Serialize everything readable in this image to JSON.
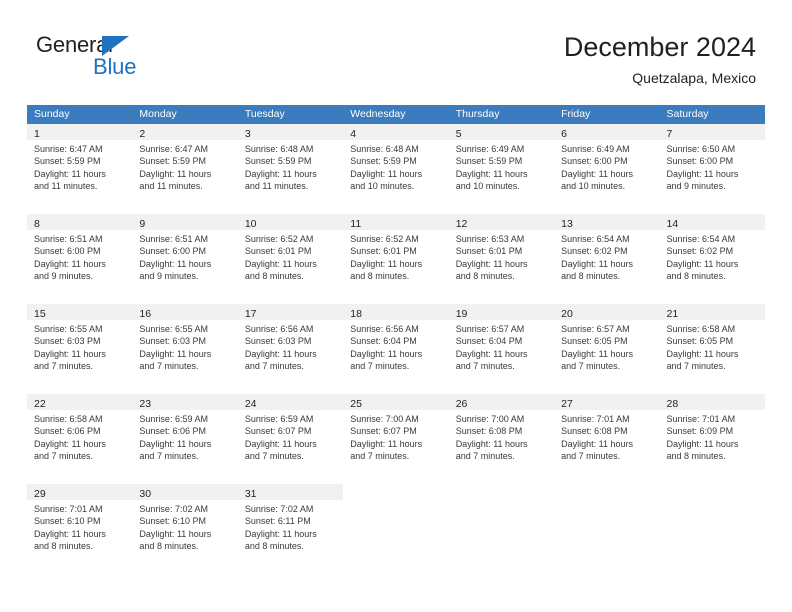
{
  "brand": {
    "name_line1": "General",
    "name_line2": "Blue",
    "accent_color": "#1e73be"
  },
  "header": {
    "title": "December 2024",
    "subtitle": "Quetzalapa, Mexico"
  },
  "calendar": {
    "header_color": "#3a7cbe",
    "daynum_band_color": "#f1f1f1",
    "weekdays": [
      "Sunday",
      "Monday",
      "Tuesday",
      "Wednesday",
      "Thursday",
      "Friday",
      "Saturday"
    ],
    "weeks": [
      [
        {
          "day": "1",
          "sunrise": "Sunrise: 6:47 AM",
          "sunset": "Sunset: 5:59 PM",
          "daylight_line1": "Daylight: 11 hours",
          "daylight_line2": "and 11 minutes."
        },
        {
          "day": "2",
          "sunrise": "Sunrise: 6:47 AM",
          "sunset": "Sunset: 5:59 PM",
          "daylight_line1": "Daylight: 11 hours",
          "daylight_line2": "and 11 minutes."
        },
        {
          "day": "3",
          "sunrise": "Sunrise: 6:48 AM",
          "sunset": "Sunset: 5:59 PM",
          "daylight_line1": "Daylight: 11 hours",
          "daylight_line2": "and 11 minutes."
        },
        {
          "day": "4",
          "sunrise": "Sunrise: 6:48 AM",
          "sunset": "Sunset: 5:59 PM",
          "daylight_line1": "Daylight: 11 hours",
          "daylight_line2": "and 10 minutes."
        },
        {
          "day": "5",
          "sunrise": "Sunrise: 6:49 AM",
          "sunset": "Sunset: 5:59 PM",
          "daylight_line1": "Daylight: 11 hours",
          "daylight_line2": "and 10 minutes."
        },
        {
          "day": "6",
          "sunrise": "Sunrise: 6:49 AM",
          "sunset": "Sunset: 6:00 PM",
          "daylight_line1": "Daylight: 11 hours",
          "daylight_line2": "and 10 minutes."
        },
        {
          "day": "7",
          "sunrise": "Sunrise: 6:50 AM",
          "sunset": "Sunset: 6:00 PM",
          "daylight_line1": "Daylight: 11 hours",
          "daylight_line2": "and 9 minutes."
        }
      ],
      [
        {
          "day": "8",
          "sunrise": "Sunrise: 6:51 AM",
          "sunset": "Sunset: 6:00 PM",
          "daylight_line1": "Daylight: 11 hours",
          "daylight_line2": "and 9 minutes."
        },
        {
          "day": "9",
          "sunrise": "Sunrise: 6:51 AM",
          "sunset": "Sunset: 6:00 PM",
          "daylight_line1": "Daylight: 11 hours",
          "daylight_line2": "and 9 minutes."
        },
        {
          "day": "10",
          "sunrise": "Sunrise: 6:52 AM",
          "sunset": "Sunset: 6:01 PM",
          "daylight_line1": "Daylight: 11 hours",
          "daylight_line2": "and 8 minutes."
        },
        {
          "day": "11",
          "sunrise": "Sunrise: 6:52 AM",
          "sunset": "Sunset: 6:01 PM",
          "daylight_line1": "Daylight: 11 hours",
          "daylight_line2": "and 8 minutes."
        },
        {
          "day": "12",
          "sunrise": "Sunrise: 6:53 AM",
          "sunset": "Sunset: 6:01 PM",
          "daylight_line1": "Daylight: 11 hours",
          "daylight_line2": "and 8 minutes."
        },
        {
          "day": "13",
          "sunrise": "Sunrise: 6:54 AM",
          "sunset": "Sunset: 6:02 PM",
          "daylight_line1": "Daylight: 11 hours",
          "daylight_line2": "and 8 minutes."
        },
        {
          "day": "14",
          "sunrise": "Sunrise: 6:54 AM",
          "sunset": "Sunset: 6:02 PM",
          "daylight_line1": "Daylight: 11 hours",
          "daylight_line2": "and 8 minutes."
        }
      ],
      [
        {
          "day": "15",
          "sunrise": "Sunrise: 6:55 AM",
          "sunset": "Sunset: 6:03 PM",
          "daylight_line1": "Daylight: 11 hours",
          "daylight_line2": "and 7 minutes."
        },
        {
          "day": "16",
          "sunrise": "Sunrise: 6:55 AM",
          "sunset": "Sunset: 6:03 PM",
          "daylight_line1": "Daylight: 11 hours",
          "daylight_line2": "and 7 minutes."
        },
        {
          "day": "17",
          "sunrise": "Sunrise: 6:56 AM",
          "sunset": "Sunset: 6:03 PM",
          "daylight_line1": "Daylight: 11 hours",
          "daylight_line2": "and 7 minutes."
        },
        {
          "day": "18",
          "sunrise": "Sunrise: 6:56 AM",
          "sunset": "Sunset: 6:04 PM",
          "daylight_line1": "Daylight: 11 hours",
          "daylight_line2": "and 7 minutes."
        },
        {
          "day": "19",
          "sunrise": "Sunrise: 6:57 AM",
          "sunset": "Sunset: 6:04 PM",
          "daylight_line1": "Daylight: 11 hours",
          "daylight_line2": "and 7 minutes."
        },
        {
          "day": "20",
          "sunrise": "Sunrise: 6:57 AM",
          "sunset": "Sunset: 6:05 PM",
          "daylight_line1": "Daylight: 11 hours",
          "daylight_line2": "and 7 minutes."
        },
        {
          "day": "21",
          "sunrise": "Sunrise: 6:58 AM",
          "sunset": "Sunset: 6:05 PM",
          "daylight_line1": "Daylight: 11 hours",
          "daylight_line2": "and 7 minutes."
        }
      ],
      [
        {
          "day": "22",
          "sunrise": "Sunrise: 6:58 AM",
          "sunset": "Sunset: 6:06 PM",
          "daylight_line1": "Daylight: 11 hours",
          "daylight_line2": "and 7 minutes."
        },
        {
          "day": "23",
          "sunrise": "Sunrise: 6:59 AM",
          "sunset": "Sunset: 6:06 PM",
          "daylight_line1": "Daylight: 11 hours",
          "daylight_line2": "and 7 minutes."
        },
        {
          "day": "24",
          "sunrise": "Sunrise: 6:59 AM",
          "sunset": "Sunset: 6:07 PM",
          "daylight_line1": "Daylight: 11 hours",
          "daylight_line2": "and 7 minutes."
        },
        {
          "day": "25",
          "sunrise": "Sunrise: 7:00 AM",
          "sunset": "Sunset: 6:07 PM",
          "daylight_line1": "Daylight: 11 hours",
          "daylight_line2": "and 7 minutes."
        },
        {
          "day": "26",
          "sunrise": "Sunrise: 7:00 AM",
          "sunset": "Sunset: 6:08 PM",
          "daylight_line1": "Daylight: 11 hours",
          "daylight_line2": "and 7 minutes."
        },
        {
          "day": "27",
          "sunrise": "Sunrise: 7:01 AM",
          "sunset": "Sunset: 6:08 PM",
          "daylight_line1": "Daylight: 11 hours",
          "daylight_line2": "and 7 minutes."
        },
        {
          "day": "28",
          "sunrise": "Sunrise: 7:01 AM",
          "sunset": "Sunset: 6:09 PM",
          "daylight_line1": "Daylight: 11 hours",
          "daylight_line2": "and 8 minutes."
        }
      ],
      [
        {
          "day": "29",
          "sunrise": "Sunrise: 7:01 AM",
          "sunset": "Sunset: 6:10 PM",
          "daylight_line1": "Daylight: 11 hours",
          "daylight_line2": "and 8 minutes."
        },
        {
          "day": "30",
          "sunrise": "Sunrise: 7:02 AM",
          "sunset": "Sunset: 6:10 PM",
          "daylight_line1": "Daylight: 11 hours",
          "daylight_line2": "and 8 minutes."
        },
        {
          "day": "31",
          "sunrise": "Sunrise: 7:02 AM",
          "sunset": "Sunset: 6:11 PM",
          "daylight_line1": "Daylight: 11 hours",
          "daylight_line2": "and 8 minutes."
        },
        null,
        null,
        null,
        null
      ]
    ]
  }
}
